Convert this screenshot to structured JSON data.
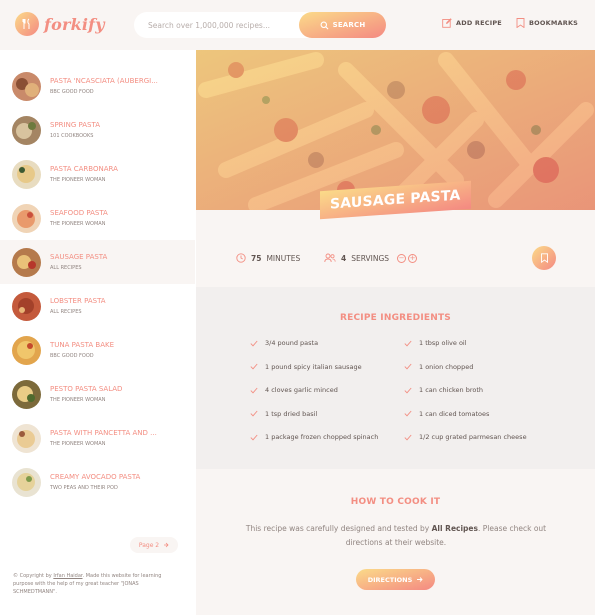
{
  "header": {
    "logo_text": "forkify",
    "search_placeholder": "Search over 1,000,000 recipes...",
    "search_label": "SEARCH",
    "add_recipe_label": "ADD RECIPE",
    "bookmarks_label": "BOOKMARKS"
  },
  "results": [
    {
      "title": "PASTA 'NCASCIATA (AUBERGI...",
      "publisher": "BBC GOOD FOOD"
    },
    {
      "title": "SPRING PASTA",
      "publisher": "101 COOKBOOKS"
    },
    {
      "title": "PASTA CARBONARA",
      "publisher": "THE PIONEER WOMAN"
    },
    {
      "title": "SEAFOOD PASTA",
      "publisher": "THE PIONEER WOMAN"
    },
    {
      "title": "SAUSAGE PASTA",
      "publisher": "ALL RECIPES"
    },
    {
      "title": "LOBSTER PASTA",
      "publisher": "ALL RECIPES"
    },
    {
      "title": "TUNA PASTA BAKE",
      "publisher": "BBC GOOD FOOD"
    },
    {
      "title": "PESTO PASTA SALAD",
      "publisher": "THE PIONEER WOMAN"
    },
    {
      "title": "PASTA WITH PANCETTA AND ...",
      "publisher": "THE PIONEER WOMAN"
    },
    {
      "title": "CREAMY AVOCADO PASTA",
      "publisher": "TWO PEAS AND THEIR POD"
    }
  ],
  "pagination": {
    "label": "Page 2"
  },
  "copyright": {
    "prefix": "© Copyright by ",
    "author": "Irfan Haidar",
    "suffix": ". Made this website for learning purpose with the help of my great teacher \"JONAS SCHMEDTMANN\"."
  },
  "recipe": {
    "title": "SAUSAGE PASTA",
    "minutes": "75",
    "minutes_label": "MINUTES",
    "servings": "4",
    "servings_label": "SERVINGS",
    "ingredients_title": "RECIPE INGREDIENTS",
    "ingredients": [
      "3/4 pound pasta",
      "1 tbsp olive oil",
      "1 pound spicy italian sausage",
      "1 onion chopped",
      "4 cloves garlic minced",
      "1 can chicken broth",
      "1 tsp dried basil",
      "1 can diced tomatoes",
      "1 package frozen chopped spinach",
      "1/2 cup grated parmesan cheese"
    ],
    "howto_title": "HOW TO COOK IT",
    "howto_text_1": "This recipe was carefully designed and tested by ",
    "howto_publisher": "All Recipes",
    "howto_text_2": ". Please check out directions at their website.",
    "directions_label": "DIRECTIONS"
  },
  "colors": {
    "accent": "#f38e82",
    "gradient_start": "#fbdb89",
    "gradient_end": "#f48982",
    "text": "#615551",
    "background": "#f9f5f3"
  }
}
